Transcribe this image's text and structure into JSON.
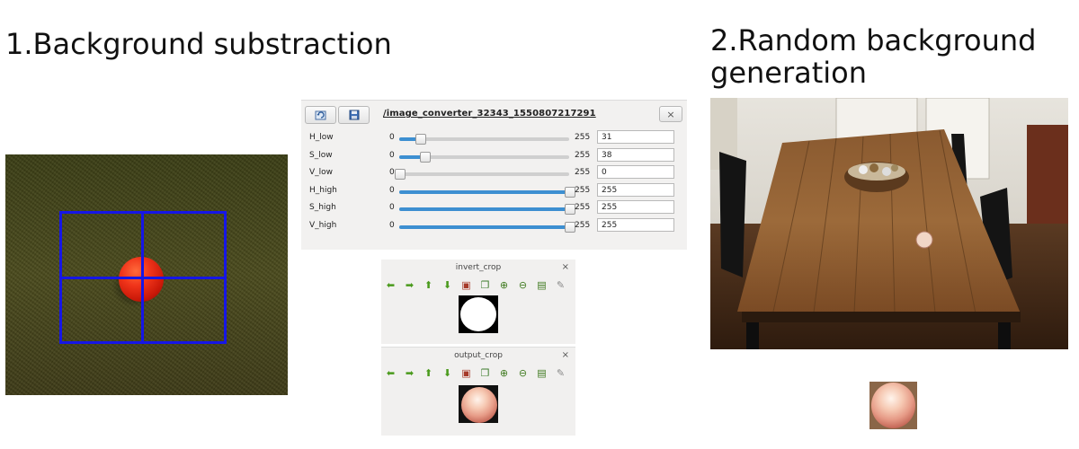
{
  "headings": {
    "left": "1.Background substraction",
    "right_line1": "2.Random background",
    "right_line2": "generation"
  },
  "hsv_panel": {
    "title": "/image_converter_32343_1550807217291",
    "close_label": "×",
    "sliders": [
      {
        "name": "H_low",
        "min": "0",
        "max": "255",
        "value": 31,
        "value_text": "31"
      },
      {
        "name": "S_low",
        "min": "0",
        "max": "255",
        "value": 38,
        "value_text": "38"
      },
      {
        "name": "V_low",
        "min": "0",
        "max": "255",
        "value": 0,
        "value_text": "0"
      },
      {
        "name": "H_high",
        "min": "0",
        "max": "255",
        "value": 255,
        "value_text": "255"
      },
      {
        "name": "S_high",
        "min": "0",
        "max": "255",
        "value": 255,
        "value_text": "255"
      },
      {
        "name": "V_high",
        "min": "0",
        "max": "255",
        "value": 255,
        "value_text": "255"
      }
    ],
    "accent_color": "#3d8fd1"
  },
  "windows": [
    {
      "title": "invert_crop",
      "close": "×"
    },
    {
      "title": "output_crop",
      "close": "×"
    }
  ],
  "toolbar_icons": [
    "arrow-left-icon",
    "arrow-right-icon",
    "arrow-up-icon",
    "arrow-down-icon",
    "image-icon",
    "fit-icon",
    "zoom-in-icon",
    "zoom-out-icon",
    "save-icon",
    "brush-icon"
  ],
  "colors": {
    "grid_overlay": "#1616e6",
    "ball": "#f0341a"
  }
}
